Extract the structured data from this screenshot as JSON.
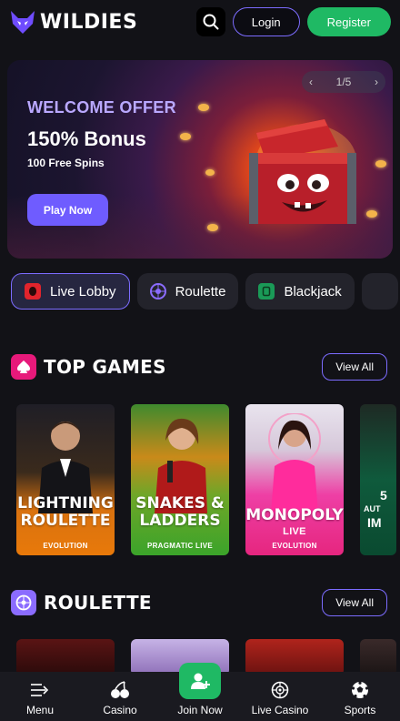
{
  "header": {
    "brand": "WILDIES",
    "login_label": "Login",
    "register_label": "Register"
  },
  "banner": {
    "offer_title": "WELCOME OFFER",
    "bonus": "150% Bonus",
    "spins": "100 Free Spins",
    "play_label": "Play Now",
    "pager": "1/5"
  },
  "categories": [
    {
      "label": "Live Lobby",
      "icon": "live-lobby-icon",
      "color": "#e2242c"
    },
    {
      "label": "Roulette",
      "icon": "roulette-icon",
      "color": "#8b6cff"
    },
    {
      "label": "Blackjack",
      "icon": "blackjack-icon",
      "color": "#1a9a57"
    }
  ],
  "top_games": {
    "title": "TOP GAMES",
    "view_all": "View All",
    "games": [
      {
        "name_1": "LIGHTNING",
        "name_2": "ROULETTE",
        "provider": "EVOLUTION"
      },
      {
        "name_1": "SNAKES &",
        "name_2": "LADDERS",
        "provider": "PRAGMATIC LIVE"
      },
      {
        "name_1": "MONOPOLY",
        "name_2": "LIVE",
        "provider": "EVOLUTION"
      },
      {
        "name_1": "5",
        "name_2": "AUT",
        "name_3": "IM"
      }
    ]
  },
  "roulette": {
    "title": "ROULETTE",
    "view_all": "View All"
  },
  "nav": {
    "menu": "Menu",
    "casino": "Casino",
    "join": "Join Now",
    "live_casino": "Live Casino",
    "sports": "Sports"
  },
  "colors": {
    "accent": "#7c6cff",
    "register": "#1fb964",
    "top_games_icon": "#e7197a",
    "roulette_icon": "#8b6cff"
  }
}
